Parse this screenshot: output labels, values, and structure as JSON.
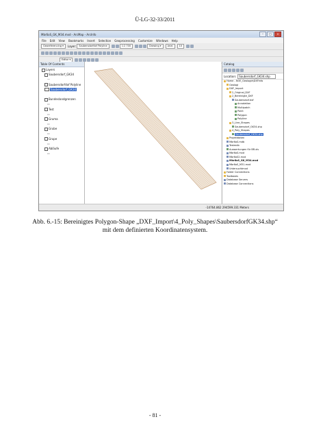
{
  "header": "Ü-LG-32-33/2011",
  "app": {
    "title": "Mbr6oS_GK_M34.mxd - ArcMap - ArcInfo",
    "menu": [
      "File",
      "Edit",
      "View",
      "Bookmarks",
      "Insert",
      "Selection",
      "Geoprocessing",
      "Customize",
      "Windows",
      "Help"
    ],
    "toolbar": {
      "georef_label": "Georeferencing ▾",
      "layer_label": "Layer:",
      "layer_value": "Saubersdorfdxf Polyline",
      "scale_value": "1:2 700",
      "drawing_label": "Drawing ▾",
      "font_value": "Arial",
      "font_size": "10",
      "editor_label": "Editor ▾"
    }
  },
  "toc": {
    "title": "Table Of Contents",
    "items": [
      {
        "label": "Layers",
        "level": 0
      },
      {
        "label": "Saubersdorf_GK34",
        "level": 1
      },
      {
        "label": "—",
        "level": 2
      },
      {
        "label": "Saubersdorfdxf Polyline",
        "level": 1
      },
      {
        "label": "Saubersdorf_GK34",
        "level": 1,
        "selected": true
      },
      {
        "label": "",
        "level": 2
      },
      {
        "label": "Bundeslandgrenzen",
        "level": 1
      },
      {
        "label": "▭",
        "level": 2
      },
      {
        "label": "Test",
        "level": 1
      },
      {
        "label": "▭",
        "level": 2
      },
      {
        "label": "Gruma",
        "level": 1
      },
      {
        "label": "▭",
        "level": 2
      },
      {
        "label": "Grube",
        "level": 1
      },
      {
        "label": "▭",
        "level": 2
      },
      {
        "label": "Grupe",
        "level": 1
      },
      {
        "label": "▭",
        "level": 2
      },
      {
        "label": "Abläufe",
        "level": 1
      },
      {
        "label": "▭",
        "level": 2
      }
    ]
  },
  "catalog": {
    "title": "Catalog",
    "location_label": "Location:",
    "location_value": "Saubersdorf_GK34.shp",
    "items": [
      {
        "label": "Home - NOE_Geologie\\DXFinfo",
        "level": 0
      },
      {
        "label": "Geologi",
        "level": 1
      },
      {
        "label": "DXF_Import",
        "level": 1
      },
      {
        "label": "2_Original_DXF",
        "level": 2
      },
      {
        "label": "2_Bereinigte_DXF",
        "level": 2
      },
      {
        "label": "Saubersdorf.dxf",
        "level": 3
      },
      {
        "label": "Annotation",
        "level": 4
      },
      {
        "label": "Multipatch",
        "level": 4
      },
      {
        "label": "Point",
        "level": 4
      },
      {
        "label": "Polygon",
        "level": 4
      },
      {
        "label": "Polyline",
        "level": 4
      },
      {
        "label": "3_Line_Shapes",
        "level": 2
      },
      {
        "label": "Saubersdorf_GK34.shp",
        "level": 3
      },
      {
        "label": "4_Poly_Shapes",
        "level": 2
      },
      {
        "label": "Saubersdorf_GK34.shp",
        "level": 3,
        "selected": true
      },
      {
        "label": "Projektdaten",
        "level": 1
      },
      {
        "label": "Mbr6oS.mdb",
        "level": 1
      },
      {
        "label": "Testmdb",
        "level": 1
      },
      {
        "label": "Auswertungen für BR.xls",
        "level": 1
      },
      {
        "label": "Mbr6oS.mxd",
        "level": 1
      },
      {
        "label": "Mbr6oS2.mxd",
        "level": 1
      },
      {
        "label": "Mbr6oS_GK_M34.mxd",
        "level": 1
      },
      {
        "label": "Mbr6oS_M31.mxd",
        "level": 1
      },
      {
        "label": "Untersuchtmxd",
        "level": 1
      },
      {
        "label": "Folder Connections",
        "level": 0
      },
      {
        "label": "Toolboxes",
        "level": 0
      },
      {
        "label": "Database Servers",
        "level": 0
      },
      {
        "label": "Database Connections",
        "level": 0
      }
    ]
  },
  "status": {
    "coords": "-14764.862  294599.331 Meters"
  },
  "caption": {
    "line1": "Abb. 6.-15: Bereinigtes Polygon-Shape „DXF_Import\\4_Poly_Shapes\\SaubersdorfGK34.shp“",
    "line2": "mit dem definierten Koordinatensystem."
  },
  "footer": "- 81 -",
  "colors": {
    "parcel_stroke": "#c29a72",
    "parcel_fill": "#e8d4b8",
    "selection": "#3166c4"
  }
}
